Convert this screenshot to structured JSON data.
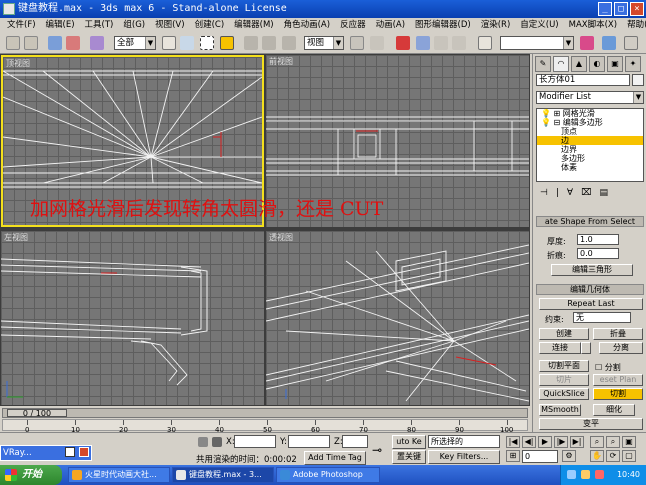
{
  "window": {
    "title": "键盘教程.max - 3ds max 6 - Stand-alone License",
    "min": "_",
    "max": "□",
    "close": "×"
  },
  "menu": [
    "文件(F)",
    "编辑(E)",
    "工具(T)",
    "组(G)",
    "视图(V)",
    "创建(C)",
    "编辑器(M)",
    "角色动画(A)",
    "反应器",
    "动画(A)",
    "图形编辑器(D)",
    "渲染(R)",
    "自定义(U)",
    "MAX脚本(X)",
    "帮助(H)"
  ],
  "toolbar": {
    "selection_filter": "全部",
    "ref_coord": "视图"
  },
  "viewports": {
    "top": "顶视图",
    "front": "前视图",
    "left": "左视图",
    "perspective": "透视图"
  },
  "annotation": "加网格光滑后发现转角太圆滑，还是 CUT",
  "command_panel": {
    "tabs": [
      "✎",
      "◠",
      "▲",
      "◐",
      "▣",
      "✦"
    ],
    "object_name": "长方体01",
    "modifier_list": "Modifier List",
    "stack": [
      {
        "label": "网格光滑",
        "level": 0,
        "selected": false
      },
      {
        "label": "编辑多边形",
        "level": 0,
        "selected": false
      },
      {
        "label": "顶点",
        "level": 1,
        "selected": false
      },
      {
        "label": "边",
        "level": 1,
        "selected": true
      },
      {
        "label": "边界",
        "level": 1,
        "selected": false
      },
      {
        "label": "多边形",
        "level": 1,
        "selected": false
      },
      {
        "label": "体素",
        "level": 1,
        "selected": false
      }
    ],
    "stack_tools": [
      "⊣",
      "|",
      "∀",
      "⌧",
      "▤"
    ],
    "extrude_rollout": "ate Shape From Select",
    "thickness_label": "厚度:",
    "thickness_value": "1.0",
    "fold_label": "折痕:",
    "fold_value": "0.0",
    "edit_tri_button": "编辑三角形",
    "edit_geometry_rollout": "编辑几何体",
    "repeat_last": "Repeat Last",
    "constraint_label": "约束:",
    "constraint_value": "无",
    "create": "创建",
    "collapse": "折叠",
    "attach": "连接",
    "detach": "分离",
    "slice_plane": "切割平面",
    "split_label": "分割",
    "slice": "切片",
    "reset_plane": "eset Plan",
    "quickslice": "QuickSlice",
    "cut": "切割",
    "msmooth": "MSmooth",
    "tessellate": "细化",
    "flatten": "变平"
  },
  "timeline": {
    "frame_display": "0 / 100",
    "ticks": [
      "0",
      "10",
      "20",
      "30",
      "40",
      "50",
      "60",
      "70",
      "80",
      "90",
      "100"
    ]
  },
  "status": {
    "vray": "VRay...",
    "x_label": "X:",
    "y_label": "Y:",
    "z_label": "Z:",
    "auto_key": "uto Ke",
    "key_mode": "所选择的",
    "set_key": "置关键",
    "key_filters": "Key Filters...",
    "render_time": "共用渲染的时间：0:00:02",
    "add_time_tag": "Add Time Tag",
    "frame": "0"
  },
  "taskbar": {
    "start": "开始",
    "tasks": [
      "火星时代动画大社...",
      "键盘教程.max - 3...",
      "Adobe Photoshop"
    ],
    "clock": "10:40"
  }
}
